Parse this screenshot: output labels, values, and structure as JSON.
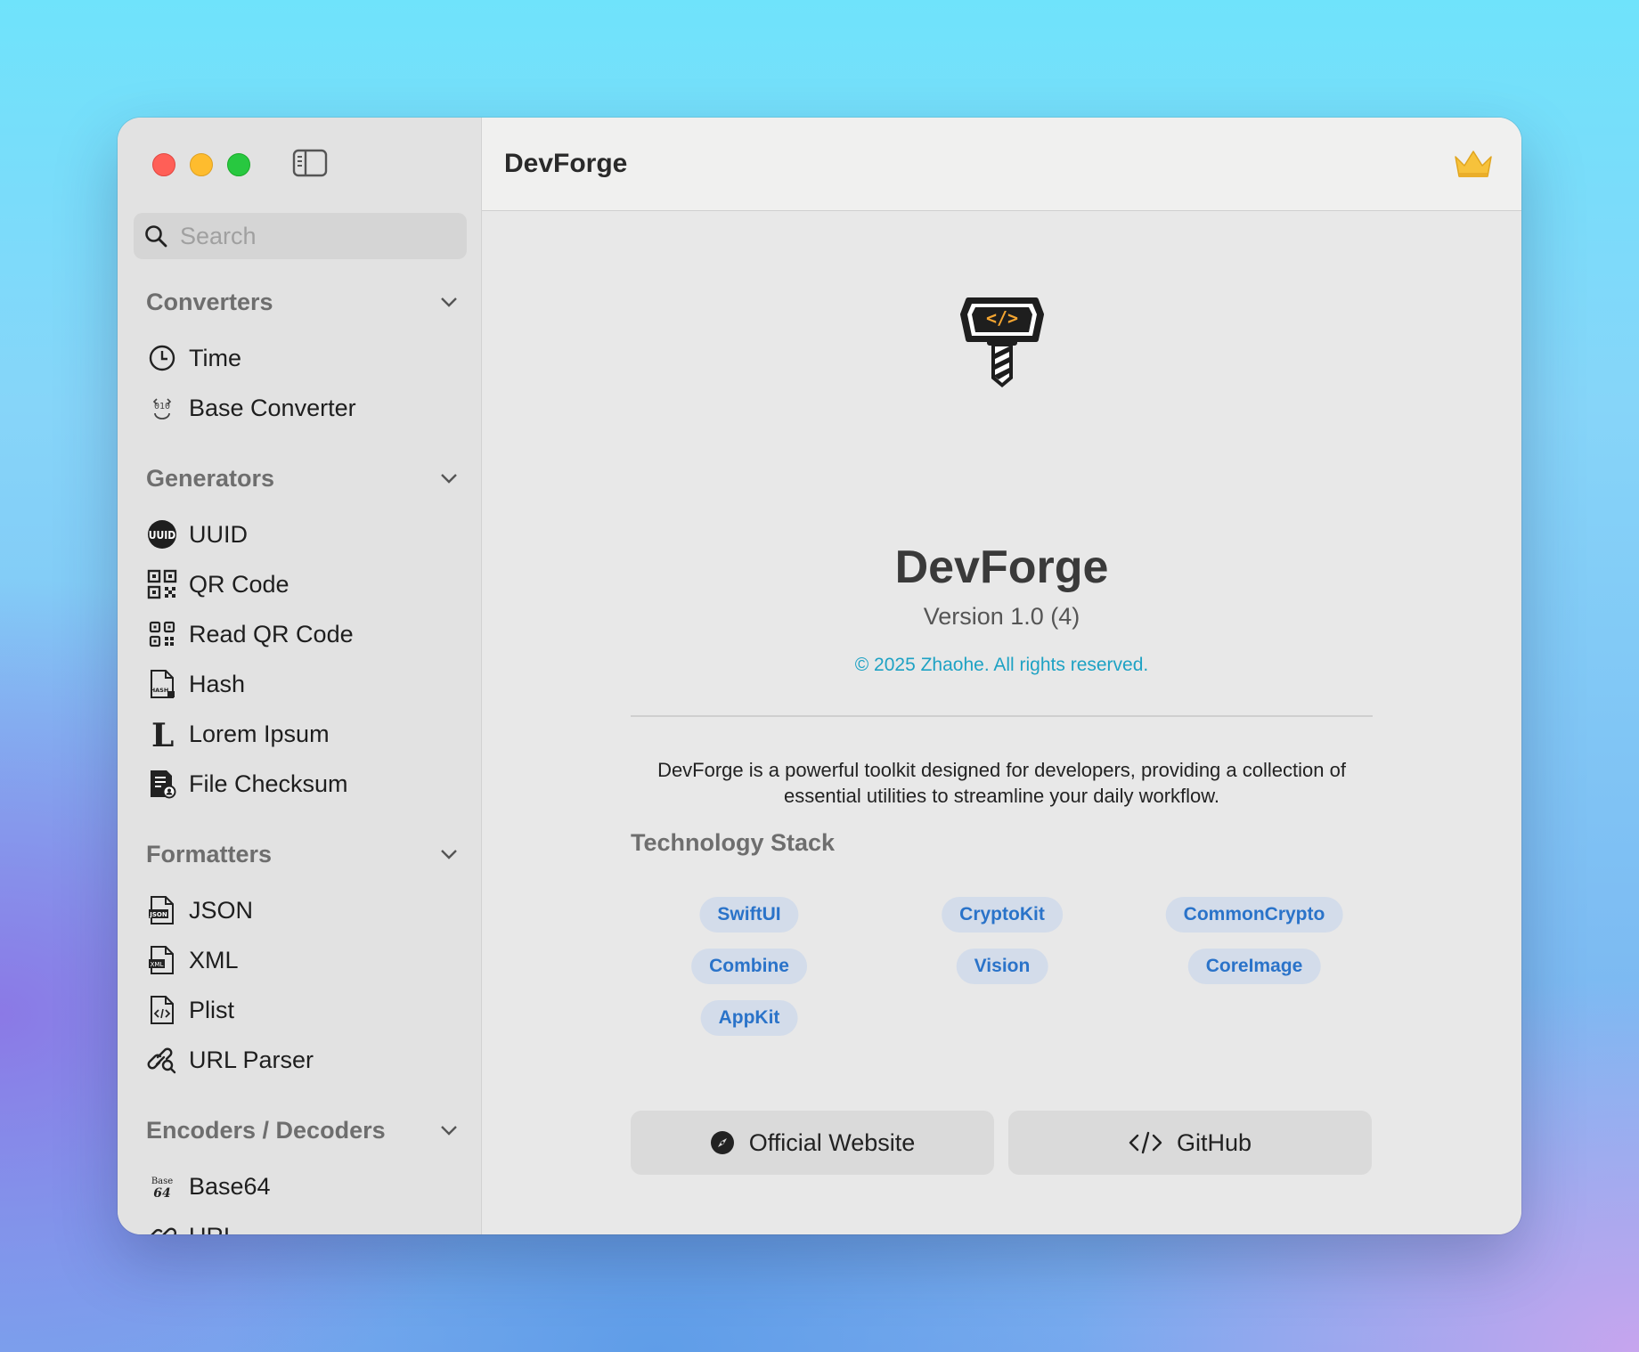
{
  "window": {
    "title": "DevForge"
  },
  "search": {
    "placeholder": "Search"
  },
  "sidebar": {
    "sections": [
      {
        "label": "Converters",
        "items": [
          {
            "label": "Time",
            "icon": "clock-icon"
          },
          {
            "label": "Base Converter",
            "icon": "base-converter-icon"
          }
        ]
      },
      {
        "label": "Generators",
        "items": [
          {
            "label": "UUID",
            "icon": "uuid-icon"
          },
          {
            "label": "QR Code",
            "icon": "qr-code-icon"
          },
          {
            "label": "Read QR Code",
            "icon": "qr-scan-icon"
          },
          {
            "label": "Hash",
            "icon": "hash-document-icon"
          },
          {
            "label": "Lorem Ipsum",
            "icon": "lorem-icon"
          },
          {
            "label": "File Checksum",
            "icon": "file-checksum-icon"
          }
        ]
      },
      {
        "label": "Formatters",
        "items": [
          {
            "label": "JSON",
            "icon": "json-document-icon"
          },
          {
            "label": "XML",
            "icon": "xml-document-icon"
          },
          {
            "label": "Plist",
            "icon": "plist-document-icon"
          },
          {
            "label": "URL Parser",
            "icon": "link-search-icon"
          }
        ]
      },
      {
        "label": "Encoders / Decoders",
        "items": [
          {
            "label": "Base64",
            "icon": "base64-icon"
          },
          {
            "label": "URL",
            "icon": "link-icon"
          }
        ]
      }
    ]
  },
  "about": {
    "app_name": "DevForge",
    "version": "Version 1.0 (4)",
    "copyright": "© 2025 Zhaohe. All rights reserved.",
    "description": "DevForge is a powerful toolkit designed for developers, providing a collection of essential utilities to streamline your daily workflow.",
    "tech_stack_title": "Technology Stack",
    "tech_stack": [
      "SwiftUI",
      "CryptoKit",
      "CommonCrypto",
      "Combine",
      "Vision",
      "CoreImage",
      "AppKit"
    ],
    "buttons": {
      "website": "Official Website",
      "github": "GitHub"
    },
    "logo_text": "</>"
  },
  "colors": {
    "accent": "#2a73c9",
    "copyright": "#1ea2c4",
    "logo_accent": "#f4a531",
    "crown": "#f7c23b"
  }
}
